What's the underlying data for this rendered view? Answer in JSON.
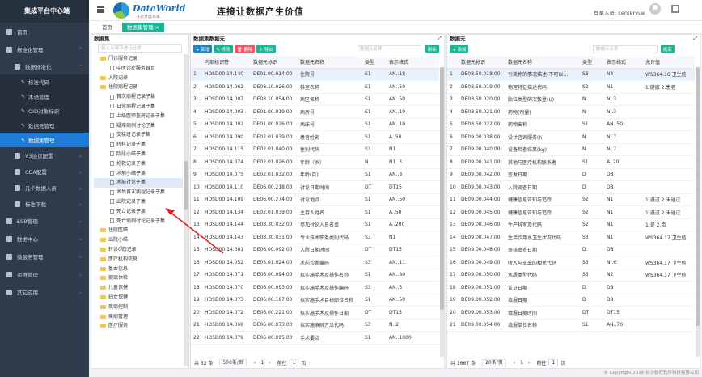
{
  "sidebar": {
    "title": "集成平台中心端",
    "items": [
      {
        "label": "首页",
        "level": 1
      },
      {
        "label": "标准化管理",
        "level": 1,
        "arrow": "⌃"
      },
      {
        "label": "数据标准化",
        "level": 2,
        "arrow": "⌃"
      },
      {
        "label": "标准代码",
        "level": 3
      },
      {
        "label": "术语管理",
        "level": 3
      },
      {
        "label": "OID对象标识",
        "level": 3
      },
      {
        "label": "数据元管理",
        "level": 3
      },
      {
        "label": "数据集管理",
        "level": 3,
        "active": true
      },
      {
        "label": "V3协议配置",
        "level": 2,
        "arrow": "⌄"
      },
      {
        "label": "CDA配置",
        "level": 2,
        "arrow": "⌄"
      },
      {
        "label": "几个数据人员",
        "level": 2,
        "arrow": "⌄"
      },
      {
        "label": "标准下载",
        "level": 2,
        "arrow": "⌄"
      },
      {
        "label": "ESB管理",
        "level": 1,
        "arrow": "⌄"
      },
      {
        "label": "数据中心",
        "level": 1,
        "arrow": "⌄"
      },
      {
        "label": "微服务管理",
        "level": 1,
        "arrow": "⌄"
      },
      {
        "label": "运维管理",
        "level": 1,
        "arrow": "⌄"
      },
      {
        "label": "其它应用",
        "level": 1,
        "arrow": "⌄"
      }
    ]
  },
  "header": {
    "logo_text": "DataWorld",
    "logo_sub": "共享开放未来",
    "slogan": "连接让数据产生价值",
    "user_label": "登录人员: centervue"
  },
  "tabs": [
    {
      "label": "首页"
    },
    {
      "label": "数据集管理 ×",
      "active": true
    }
  ],
  "tree_panel": {
    "title": "数据集",
    "search_placeholder": "输入关键字进行过滤",
    "rows": [
      {
        "label": "门诊服务记录",
        "type": "folder",
        "indent": 1
      },
      {
        "label": "中医诊疗服务首页",
        "type": "doc",
        "indent": 2
      },
      {
        "label": "入院记录",
        "type": "folder",
        "indent": 1
      },
      {
        "label": "住院病程记录",
        "type": "folder",
        "indent": 1
      },
      {
        "label": "首次病程记录子集",
        "type": "doc",
        "indent": 2
      },
      {
        "label": "日常病程记录子集",
        "type": "doc",
        "indent": 2
      },
      {
        "label": "上级医师查房记录子集",
        "type": "doc",
        "indent": 2
      },
      {
        "label": "疑难病例讨论子集",
        "type": "doc",
        "indent": 2
      },
      {
        "label": "交接班记录子集",
        "type": "doc",
        "indent": 2
      },
      {
        "label": "转科记录子集",
        "type": "doc",
        "indent": 2
      },
      {
        "label": "阶段小结子集",
        "type": "doc",
        "indent": 2
      },
      {
        "label": "抢救记录子集",
        "type": "doc",
        "indent": 2
      },
      {
        "label": "术前小结子集",
        "type": "doc",
        "indent": 2
      },
      {
        "label": "术前讨论子集",
        "type": "doc",
        "indent": 2,
        "highlight": true
      },
      {
        "label": "术后首次病程记录子集",
        "type": "doc",
        "indent": 2
      },
      {
        "label": "出院记录子集",
        "type": "doc",
        "indent": 2
      },
      {
        "label": "死亡记录子集",
        "type": "doc",
        "indent": 2
      },
      {
        "label": "死亡病例讨论记录子集",
        "type": "doc",
        "indent": 2
      },
      {
        "label": "住院医嘱",
        "type": "folder",
        "indent": 1
      },
      {
        "label": "出院小结",
        "type": "folder",
        "indent": 1
      },
      {
        "label": "转诊(院)记录",
        "type": "folder",
        "indent": 1
      },
      {
        "label": "医疗机构信息",
        "type": "folder",
        "indent": 1
      },
      {
        "label": "基本信息",
        "type": "folder",
        "indent": 1
      },
      {
        "label": "健康体检",
        "type": "folder",
        "indent": 1
      },
      {
        "label": "儿童保健",
        "type": "folder",
        "indent": 1
      },
      {
        "label": "妇女保健",
        "type": "folder",
        "indent": 1
      },
      {
        "label": "疾病控制",
        "type": "folder",
        "indent": 1
      },
      {
        "label": "疾病管理",
        "type": "folder",
        "indent": 1
      },
      {
        "label": "医疗服务",
        "type": "folder",
        "indent": 1
      }
    ]
  },
  "mid_panel": {
    "title": "数据集数据元",
    "buttons": [
      "+ 新增",
      "✎ 修改",
      "🗑 删除",
      "⇪ 导出"
    ],
    "search_placeholder": "数据元名称",
    "refresh_label": "刷新",
    "columns": [
      "",
      "内部标识符",
      "数据元标识",
      "数据元名称",
      "类型",
      "表示格式"
    ],
    "rows": [
      [
        "1",
        "HDSD00.14.140",
        "DE01.00.014.00",
        "住院号",
        "S1",
        "AN..18"
      ],
      [
        "2",
        "HDSD00.14.062",
        "DE08.10.026.00",
        "科室名称",
        "S1",
        "AN..50"
      ],
      [
        "3",
        "HDSD00.14.007",
        "DE08.10.054.00",
        "病区名称",
        "S1",
        "AN..50"
      ],
      [
        "4",
        "HDSD00.14.003",
        "DE01.00.019.00",
        "病房号",
        "S1",
        "AN..10"
      ],
      [
        "5",
        "HDSD00.14.002",
        "DE01.00.026.00",
        "病床号",
        "S1",
        "AN..10"
      ],
      [
        "6",
        "HDSD00.14.090",
        "DE02.01.039.00",
        "患者姓名",
        "S1",
        "A..50"
      ],
      [
        "7",
        "HDSD00.14.115",
        "DE02.01.040.00",
        "性别代码",
        "S3",
        "N1"
      ],
      [
        "8",
        "HDSD00.14.074",
        "DE02.01.026.00",
        "年龄（岁）",
        "N",
        "N1..3"
      ],
      [
        "9",
        "HDSD00.14.075",
        "DE02.01.032.00",
        "年龄(月)",
        "S1",
        "AN..8"
      ],
      [
        "10",
        "HDSD00.14.110",
        "DE06.00.218.00",
        "讨论日期时间",
        "DT",
        "DT15"
      ],
      [
        "11",
        "HDSD00.14.109",
        "DE06.00.274.00",
        "讨论地点",
        "S1",
        "AN..50"
      ],
      [
        "12",
        "HDSD00.14.134",
        "DE02.01.039.00",
        "主持人姓名",
        "S1",
        "A..50"
      ],
      [
        "13",
        "HDSD00.14.144",
        "DE08.30.032.00",
        "参加讨论人员名单",
        "S1",
        "A..200"
      ],
      [
        "14",
        "HDSD00.14.143",
        "DE08.30.031.00",
        "专业技术职务类别代码",
        "S3",
        "N1"
      ],
      [
        "15",
        "HDSD00.14.081",
        "DE06.00.092.00",
        "入院日期时间",
        "DT",
        "DT15"
      ],
      [
        "16",
        "HDSD00.14.052",
        "DE05.01.024.00",
        "术前诊断编码",
        "S3",
        "AN..11"
      ],
      [
        "17",
        "HDSD00.14.071",
        "DE06.00.094.00",
        "拟实施手术及操作名称",
        "S1",
        "AN..80"
      ],
      [
        "18",
        "HDSD00.14.070",
        "DE06.00.093.00",
        "拟实施手术及操作编码",
        "S3",
        "AN..5"
      ],
      [
        "19",
        "HDSD00.14.073",
        "DE06.00.187.00",
        "拟实施手术目标部位名称",
        "S1",
        "AN..50"
      ],
      [
        "20",
        "HDSD00.14.072",
        "DE06.00.221.00",
        "拟实施手术及操作日期",
        "DT",
        "DT15"
      ],
      [
        "21",
        "HDSD00.14.069",
        "DE06.00.073.00",
        "拟实施麻醉方法代码",
        "S3",
        "N..2"
      ],
      [
        "22",
        "HDSD00.14.078",
        "DE06.00.095.00",
        "手术要点",
        "S1",
        "AN..1000"
      ]
    ],
    "total_label": "共 32 条",
    "page_size": "500条/页",
    "prev_label": "前往",
    "page": "1",
    "page_unit": "页"
  },
  "right_panel": {
    "title": "数据元",
    "buttons": [
      "+ 添加"
    ],
    "search_placeholder": "数据元名称",
    "refresh_label": "刷新",
    "columns": [
      "",
      "数据元标识",
      "数据元名称",
      "类型",
      "表示格式",
      "允许值"
    ],
    "rows": [
      [
        "1",
        "DE08.50.018.00",
        "引流物的情况描述(不可以…",
        "S3",
        "N4",
        "WS364.16 卫生信"
      ],
      [
        "2",
        "DE08.50.019.00",
        "物理特征描述代码",
        "S2",
        "N1",
        "1.健康 2.患者"
      ],
      [
        "3",
        "DE08.50.020.00",
        "胎位类型的次数量(U)",
        "N",
        "N..3",
        ""
      ],
      [
        "4",
        "DE08.50.021.00",
        "药物(剂量)",
        "N",
        "N..3",
        ""
      ],
      [
        "5",
        "DE08.50.022.00",
        "药物名称",
        "S1",
        "AN..50",
        ""
      ],
      [
        "6",
        "DE09.00.038.00",
        "设计咨询服务(h)",
        "N",
        "N..7",
        ""
      ],
      [
        "7",
        "DE09.00.040.00",
        "设备检查结果(kg)",
        "N",
        "N..7",
        ""
      ],
      [
        "8",
        "DE09.00.041.00",
        "其他与医疗机构联系者",
        "S1",
        "A..20",
        ""
      ],
      [
        "9",
        "DE09.00.042.00",
        "签发日期",
        "D",
        "D8",
        ""
      ],
      [
        "10",
        "DE09.00.043.00",
        "入院调查日期",
        "D",
        "D8",
        ""
      ],
      [
        "11",
        "DE09.00.044.00",
        "健康信息告知与追踪",
        "S2",
        "N1",
        "1.遇过 2.未通过"
      ],
      [
        "12",
        "DE09.00.045.00",
        "健康信息告知与追踪",
        "S2",
        "N1",
        "1.遇过 2.未通过"
      ],
      [
        "13",
        "DE09.00.046.00",
        "生产科室及代码",
        "S2",
        "N1",
        "1.是 2.否"
      ],
      [
        "14",
        "DE09.00.047.00",
        "生活饮用水卫生状况代码",
        "S3",
        "N1",
        "WS364.17 卫生信"
      ],
      [
        "15",
        "DE09.00.048.00",
        "审核审查日期",
        "D",
        "D8",
        ""
      ],
      [
        "16",
        "DE09.00.049.00",
        "收入与支出的相关代码",
        "S3",
        "N..6",
        "WS364.17 卫生信"
      ],
      [
        "17",
        "DE09.00.050.00",
        "水质类型代码",
        "S3",
        "N2",
        "WS364.17 卫生信"
      ],
      [
        "18",
        "DE09.00.051.00",
        "认证日期",
        "D",
        "D8",
        ""
      ],
      [
        "19",
        "DE09.00.052.00",
        "填报日期",
        "D",
        "D8",
        ""
      ],
      [
        "20",
        "DE09.00.053.00",
        "填报日期时间",
        "DT",
        "DT15",
        ""
      ],
      [
        "21",
        "DE09.00.054.00",
        "填报单位名称",
        "S1",
        "AN..70",
        ""
      ]
    ],
    "total_label": "共 1667 条",
    "page_size": "20条/页",
    "prev_label": "前往",
    "page": "1",
    "page_unit": "页"
  },
  "footer": "© Copyright 2016 长沙数旺软件科技有限公司",
  "accent": "#1ab394"
}
